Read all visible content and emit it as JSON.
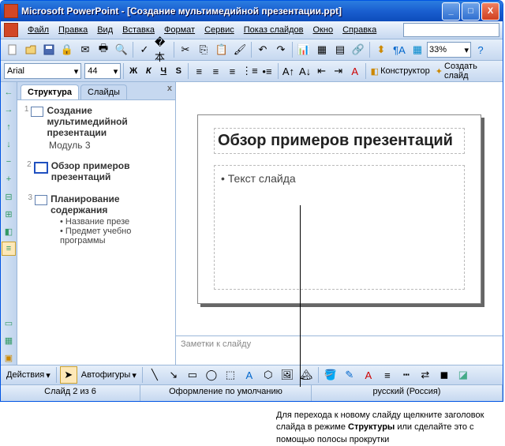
{
  "title": "Microsoft PowerPoint - [Создание мультимедийной презентации.ppt]",
  "winbtns": {
    "min": "_",
    "max": "□",
    "close": "X"
  },
  "menu": [
    "Файл",
    "Правка",
    "Вид",
    "Вставка",
    "Формат",
    "Сервис",
    "Показ слайдов",
    "Окно",
    "Справка"
  ],
  "toolbar1": {
    "zoom": "33%"
  },
  "toolbar2": {
    "font": "Arial",
    "size": "44",
    "bold": "Ж",
    "italic": "К",
    "underline": "Ч",
    "shadow": "S",
    "designer": "Конструктор",
    "newslide": "Создать слайд"
  },
  "tabs": {
    "outline": "Структура",
    "slides": "Слайды",
    "close": "x"
  },
  "outline": {
    "items": [
      {
        "num": "1",
        "title": "Создание мультимедийной презентации",
        "sub": "Модуль 3"
      },
      {
        "num": "2",
        "title": "Обзор примеров презентаций"
      },
      {
        "num": "3",
        "title": "Планирование содержания",
        "bullets": [
          "Название презе",
          "Предмет учебно программы"
        ]
      }
    ]
  },
  "slide": {
    "title": "Обзор примеров презентаций",
    "body": "• Текст слайда"
  },
  "notes": "Заметки к слайду",
  "drawbar": {
    "actions": "Действия",
    "autoshapes": "Автофигуры"
  },
  "status": {
    "slide": "Слайд 2 из 6",
    "design": "Оформление по умолчанию",
    "lang": "русский (Россия)"
  },
  "callout": "Для перехода к новому слайду щелкните заголовок слайда в режиме Структуры или сделайте это с помощью полосы прокрутки",
  "callout_bold": "Структуры"
}
